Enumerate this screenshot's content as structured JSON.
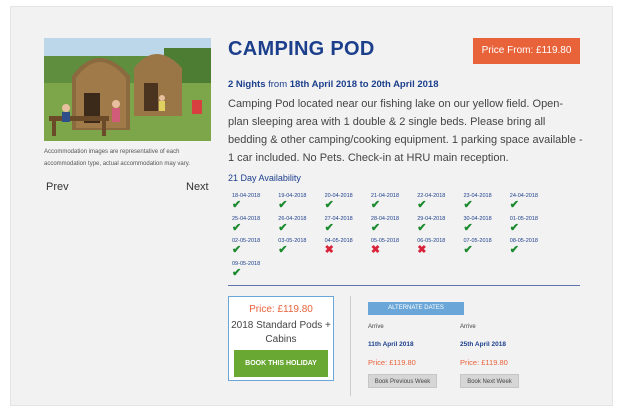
{
  "product": {
    "title": "CAMPING POD",
    "price_button": "Price From: £119.80",
    "nights_bold": "2 Nights",
    "nights_from": "from",
    "date_range": "18th April 2018 to 20th April 2018",
    "description": "Camping Pod located near our fishing lake on our yellow field. Open-plan sleeping area with 1 double & 2 single beds. Please bring all bedding & other camping/cooking equipment. 1 parking space available - 1 car included. No Pets. Check-in at HRU main reception."
  },
  "gallery": {
    "caption": "Accommodation images are representative of each accommodation type, actual accommodation may vary.",
    "prev_label": "Prev",
    "next_label": "Next"
  },
  "availability": {
    "title": "21 Day Availability",
    "days": [
      {
        "date": "18-04-2018",
        "available": true
      },
      {
        "date": "19-04-2018",
        "available": true
      },
      {
        "date": "20-04-2018",
        "available": true
      },
      {
        "date": "21-04-2018",
        "available": true
      },
      {
        "date": "22-04-2018",
        "available": true
      },
      {
        "date": "23-04-2018",
        "available": true
      },
      {
        "date": "24-04-2018",
        "available": true
      },
      {
        "date": "25-04-2018",
        "available": true
      },
      {
        "date": "26-04-2018",
        "available": true
      },
      {
        "date": "27-04-2018",
        "available": true
      },
      {
        "date": "28-04-2018",
        "available": true
      },
      {
        "date": "29-04-2018",
        "available": true
      },
      {
        "date": "30-04-2018",
        "available": true
      },
      {
        "date": "01-05-2018",
        "available": true
      },
      {
        "date": "02-05-2018",
        "available": true
      },
      {
        "date": "03-05-2018",
        "available": true
      },
      {
        "date": "04-05-2018",
        "available": false
      },
      {
        "date": "05-05-2018",
        "available": false
      },
      {
        "date": "06-05-2018",
        "available": false
      },
      {
        "date": "07-05-2018",
        "available": true
      },
      {
        "date": "08-05-2018",
        "available": true
      },
      {
        "date": "09-05-2018",
        "available": true
      }
    ],
    "check_icon": "checkmark-icon",
    "cross_icon": "cross-icon",
    "colors": {
      "available": "#1a8a2e",
      "unavailable": "#d9233a"
    }
  },
  "selected": {
    "price": "Price: £119.80",
    "name": "2018 Standard Pods + Cabins",
    "book_label": "BOOK THIS HOLIDAY"
  },
  "alternates": {
    "header": "ALTERNATE DATES",
    "items": [
      {
        "arrive_label": "Arrive",
        "date": "11th April 2018",
        "price": "Price: £119.80",
        "button": "Book Previous Week"
      },
      {
        "arrive_label": "Arrive",
        "date": "25th April 2018",
        "price": "Price: £119.80",
        "button": "Book Next Week"
      }
    ]
  },
  "colors": {
    "brand_blue": "#1c3f8c",
    "accent_orange": "#e8623a",
    "book_green": "#6aa834",
    "light_blue": "#6aa7d8"
  }
}
